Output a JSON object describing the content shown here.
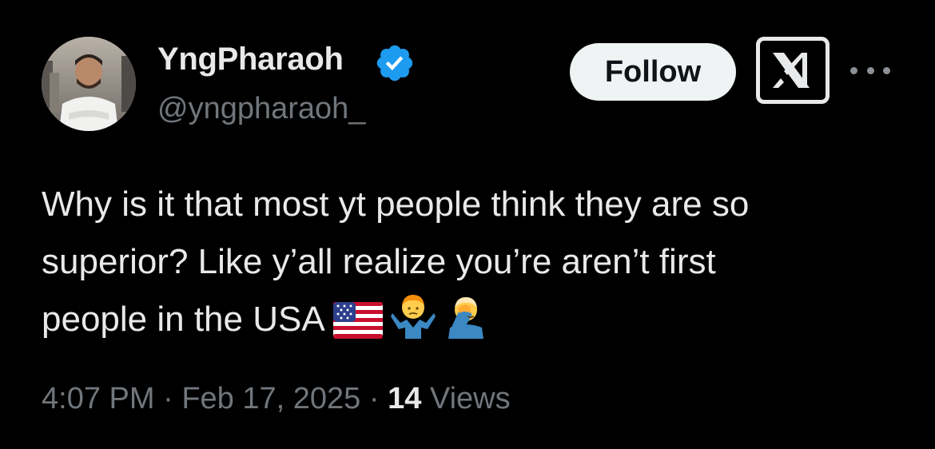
{
  "author": {
    "display_name": "YngPharaoh",
    "handle": "@yngpharaoh_",
    "verified": true,
    "verified_color": "#1d9bf0",
    "avatar_icon": "profile-photo"
  },
  "actions": {
    "follow_label": "Follow",
    "platform_logo": "x-logo-icon",
    "more_icon": "more-dots-icon"
  },
  "tweet": {
    "lines": [
      "Why is it that most yt people think they are so",
      "superior? Like y’all realize you’re aren’t first",
      "people in the USA"
    ],
    "emojis": [
      "us-flag-emoji",
      "person-shrugging-emoji",
      "person-facepalming-emoji"
    ]
  },
  "meta": {
    "time": "4:07 PM",
    "separator": " · ",
    "date": "Feb 17, 2025",
    "views_count": "14",
    "views_label": "Views"
  },
  "colors": {
    "background": "#000000",
    "text": "#e7e9ea",
    "secondary_text": "#71767b",
    "follow_bg": "#eff3f4"
  }
}
